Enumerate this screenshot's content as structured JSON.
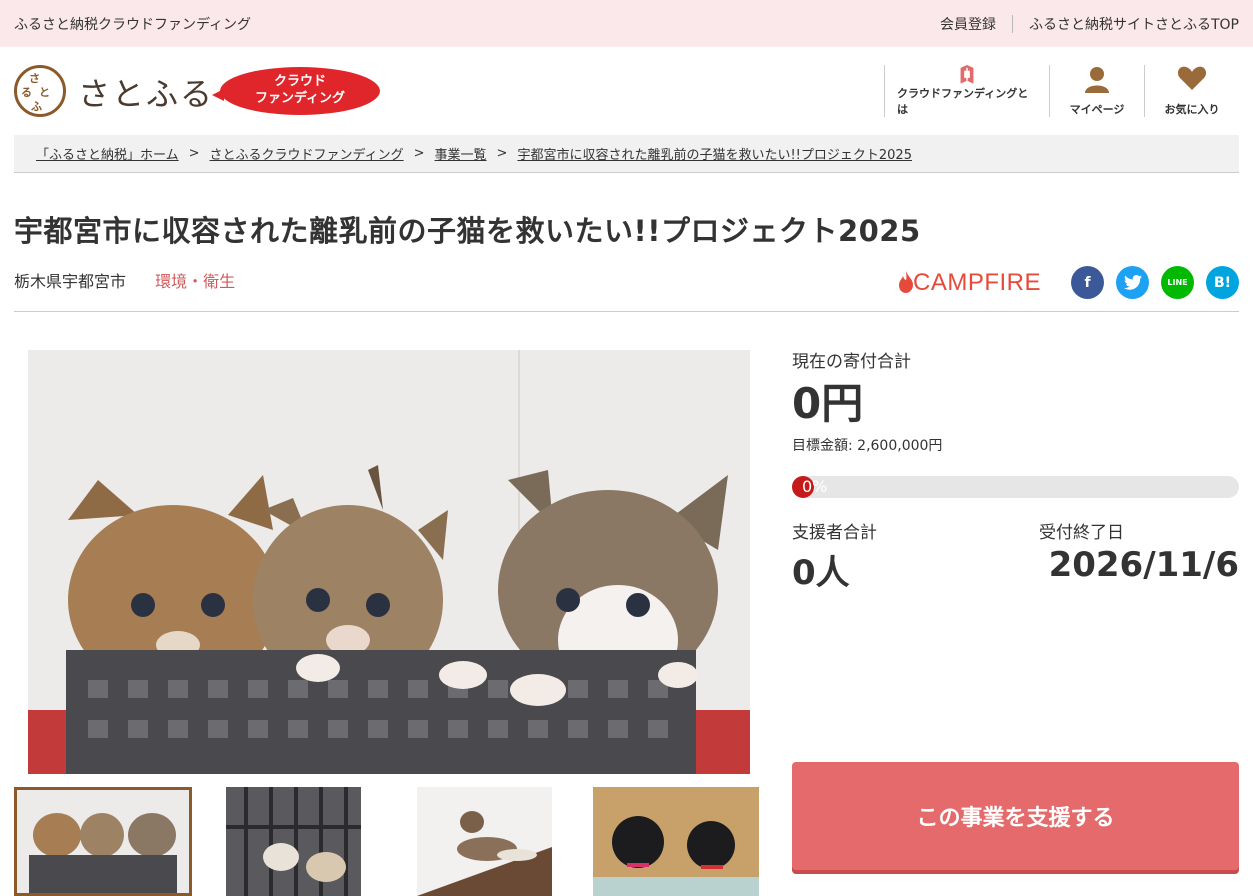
{
  "topbar": {
    "site_title": "ふるさと納税クラウドファンディング",
    "register": "会員登録",
    "satofull_top": "ふるさと納税サイトさとふるTOP"
  },
  "header": {
    "logo_text": "さとふる",
    "badge_line1": "クラウド",
    "badge_line2": "ファンディング",
    "nav": [
      {
        "label": "クラウドファンディングとは",
        "icon": "book-icon"
      },
      {
        "label": "マイページ",
        "icon": "person-icon"
      },
      {
        "label": "お気に入り",
        "icon": "heart-icon"
      }
    ]
  },
  "breadcrumb": [
    "「ふるさと納税」ホーム",
    "さとふるクラウドファンディング",
    "事業一覧",
    "宇都宮市に収容された離乳前の子猫を救いたい!!プロジェクト2025"
  ],
  "project": {
    "title": "宇都宮市に収容された離乳前の子猫を救いたい!!プロジェクト2025",
    "city": "栃木県宇都宮市",
    "category": "環境・衛生"
  },
  "share": {
    "campfire": "CAMPFIRE",
    "facebook": "f",
    "line": "LINE",
    "hatena": "B!"
  },
  "stats": {
    "total_label": "現在の寄付合計",
    "total_value": "0円",
    "goal_text": "目標金額: 2,600,000円",
    "progress_text": "0%",
    "progress_fraction": 0,
    "supporters_label": "支援者合計",
    "supporters_value": "0人",
    "deadline_label": "受付終了日",
    "deadline_value": "2026/11/6"
  },
  "support_button": "この事業を支援する",
  "colors": {
    "topbar_bg": "#fbe8ea",
    "accent": "#e0262b",
    "support_button": "#e46a6b",
    "category": "#d05a5a",
    "logo_brown": "#8a5a2b"
  }
}
